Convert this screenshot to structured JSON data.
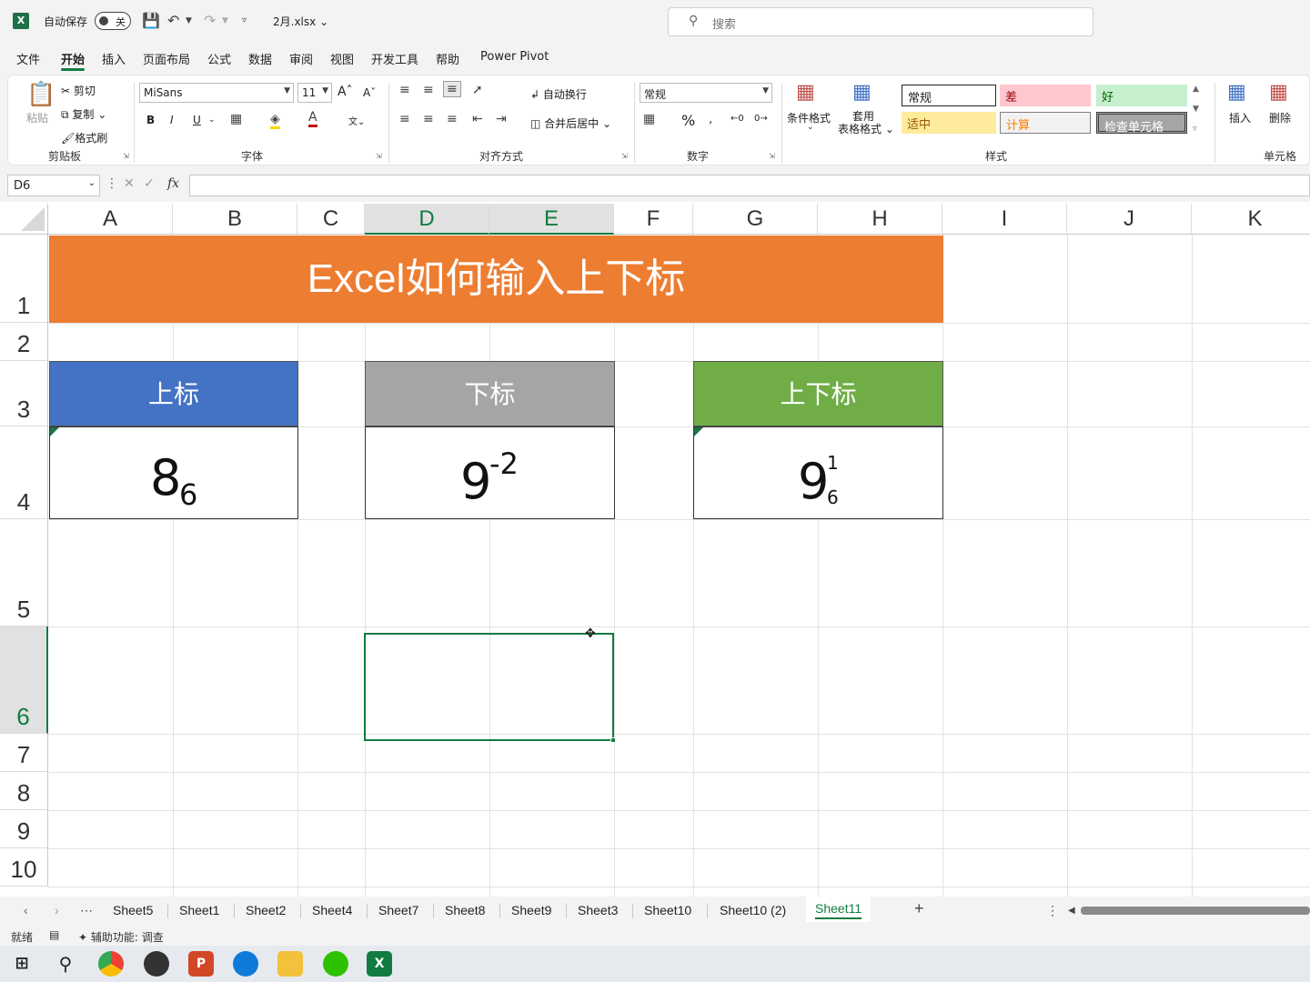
{
  "titlebar": {
    "autosave": "自动保存",
    "autosave_state": "关",
    "filename": "2月.xlsx",
    "search_placeholder": "搜索",
    "app_icon_letter": "X"
  },
  "menu": [
    "文件",
    "开始",
    "插入",
    "页面布局",
    "公式",
    "数据",
    "审阅",
    "视图",
    "开发工具",
    "帮助",
    "Power Pivot"
  ],
  "menu_active_index": 1,
  "ribbon": {
    "clipboard": {
      "paste": "粘贴",
      "cut": "剪切",
      "copy": "复制",
      "format_painter": "格式刷",
      "label": "剪贴板"
    },
    "font": {
      "name": "MiSans",
      "size": "11",
      "label": "字体",
      "bold": "B",
      "italic": "I",
      "underline": "U"
    },
    "alignment": {
      "wrap": "自动换行",
      "merge": "合并后居中",
      "label": "对齐方式"
    },
    "number": {
      "format": "常规",
      "percent": "%",
      "label": "数字"
    },
    "styles": {
      "conditional": "条件格式",
      "table_format_1": "套用",
      "table_format_2": "表格格式",
      "cells": [
        "常规",
        "差",
        "好",
        "适中",
        "计算",
        "检查单元格"
      ],
      "label": "样式"
    },
    "cells": {
      "insert": "插入",
      "delete": "删除",
      "label": "单元格"
    }
  },
  "formula_bar": {
    "name_box": "D6",
    "value": "",
    "fx": "fx"
  },
  "columns": [
    "A",
    "B",
    "C",
    "D",
    "E",
    "F",
    "G",
    "H",
    "I",
    "J",
    "K"
  ],
  "rows": [
    "1",
    "2",
    "3",
    "4",
    "5",
    "6",
    "7",
    "8",
    "9",
    "10"
  ],
  "selected_cell": "D6",
  "sheet": {
    "title": "Excel如何输入上下标",
    "superscript_header": "上标",
    "subscript_header": "下标",
    "both_header": "上下标",
    "cell_A4_base": "8",
    "cell_A4_sub": "6",
    "cell_D4_base": "9",
    "cell_D4_sup": "-2",
    "cell_G4_base": "9",
    "cell_G4_sup": "1",
    "cell_G4_sub": "6",
    "colors": {
      "banner": "#ED7D31",
      "superscript": "#4472C4",
      "subscript": "#A5A5A5",
      "both": "#70AD47"
    }
  },
  "tabs": [
    "Sheet5",
    "Sheet1",
    "Sheet2",
    "Sheet4",
    "Sheet7",
    "Sheet8",
    "Sheet9",
    "Sheet3",
    "Sheet10",
    "Sheet10 (2)",
    "Sheet11"
  ],
  "active_tab": "Sheet11",
  "status": {
    "ready": "就绪",
    "accessibility": "辅助功能: 调查"
  }
}
